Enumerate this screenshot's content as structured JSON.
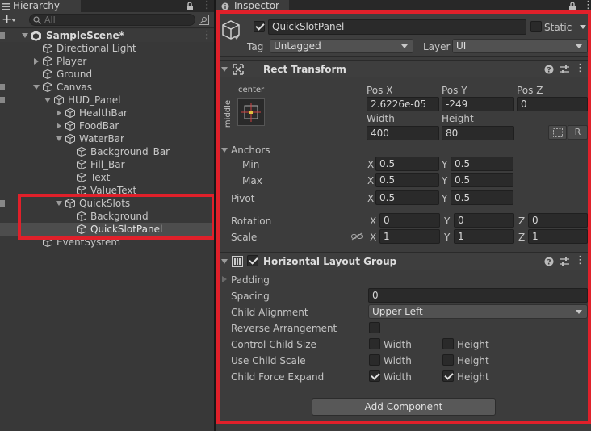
{
  "hierarchy": {
    "tab_label": "Hierarchy",
    "add_label": "+",
    "search_placeholder": "All",
    "items": [
      {
        "label": "SampleScene*"
      },
      {
        "label": "Directional Light"
      },
      {
        "label": "Player"
      },
      {
        "label": "Ground"
      },
      {
        "label": "Canvas"
      },
      {
        "label": "HUD_Panel"
      },
      {
        "label": "HealthBar"
      },
      {
        "label": "FoodBar"
      },
      {
        "label": "WaterBar"
      },
      {
        "label": "Background_Bar"
      },
      {
        "label": "Fill_Bar"
      },
      {
        "label": "Text"
      },
      {
        "label": "ValueText"
      },
      {
        "label": "QuickSlots"
      },
      {
        "label": "Background"
      },
      {
        "label": "QuickSlotPanel"
      },
      {
        "label": "EventSystem"
      }
    ]
  },
  "inspector": {
    "tab_label": "Inspector",
    "object_name": "QuickSlotPanel",
    "static_label": "Static",
    "tag_label": "Tag",
    "tag_value": "Untagged",
    "layer_label": "Layer",
    "layer_value": "UI",
    "rect": {
      "title": "Rect Transform",
      "anchor_h": "center",
      "anchor_v": "middle",
      "posx_label": "Pos X",
      "posy_label": "Pos Y",
      "posz_label": "Pos Z",
      "posx": "2.6226e-05",
      "posy": "-249",
      "posz": "0",
      "width_label": "Width",
      "height_label": "Height",
      "width": "400",
      "height": "80",
      "r_label": "R",
      "anchors_label": "Anchors",
      "min_label": "Min",
      "max_label": "Max",
      "pivot_label": "Pivot",
      "x_axis": "X",
      "y_axis": "Y",
      "z_axis": "Z",
      "min_x": "0.5",
      "min_y": "0.5",
      "max_x": "0.5",
      "max_y": "0.5",
      "pivot_x": "0.5",
      "pivot_y": "0.5",
      "rotation_label": "Rotation",
      "rot_x": "0",
      "rot_y": "0",
      "rot_z": "0",
      "scale_label": "Scale",
      "scale_x": "1",
      "scale_y": "1",
      "scale_z": "1"
    },
    "hlg": {
      "title": "Horizontal Layout Group",
      "padding_label": "Padding",
      "spacing_label": "Spacing",
      "spacing": "0",
      "child_alignment_label": "Child Alignment",
      "child_alignment": "Upper Left",
      "reverse_label": "Reverse Arrangement",
      "control_size_label": "Control Child Size",
      "use_scale_label": "Use Child Scale",
      "force_expand_label": "Child Force Expand",
      "width_label": "Width",
      "height_label": "Height"
    },
    "add_component_label": "Add Component"
  },
  "accent": {
    "highlight_red": "#e0202a",
    "selected_row": "#4d4d4d"
  }
}
